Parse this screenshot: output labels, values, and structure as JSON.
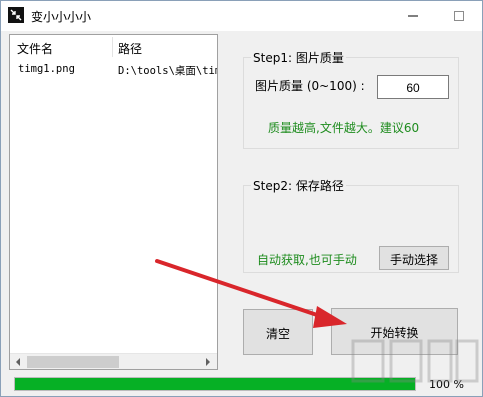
{
  "window": {
    "title": "变小小小小"
  },
  "file_list": {
    "columns": [
      "文件名",
      "路径"
    ],
    "rows": [
      {
        "name": "timg1.png",
        "path": "D:\\tools\\桌面\\tim"
      }
    ]
  },
  "step1": {
    "title": "Step1: 图片质量",
    "quality_label": "图片质量 (0~100) :",
    "quality_value": "60",
    "tip": "质量越高,文件越大。建议60"
  },
  "step2": {
    "title": "Step2: 保存路径",
    "tip": "自动获取,也可手动",
    "manual_button": "手动选择"
  },
  "actions": {
    "clear_button": "清空",
    "start_button": "开始转换"
  },
  "progress": {
    "percent": 100,
    "label": "100 %"
  },
  "colors": {
    "progress_fill": "#06b025",
    "tip_text": "#1e8c1e",
    "arrow": "#d9262b"
  },
  "icons": {
    "app": "compress-icon",
    "minimize": "minimize-icon",
    "maximize": "maximize-icon"
  }
}
